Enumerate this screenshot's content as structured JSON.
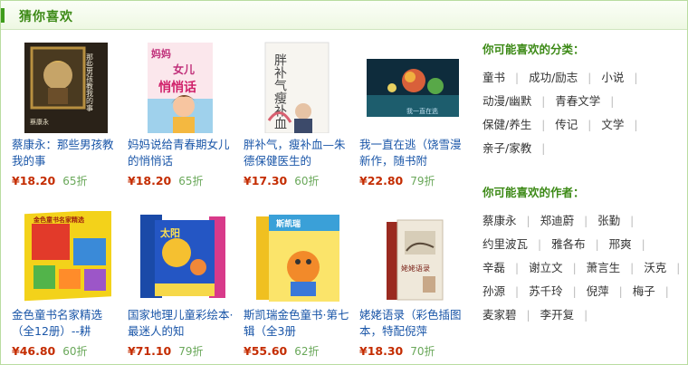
{
  "section_title": "猜你喜欢",
  "products": [
    {
      "title": "蔡康永：那些男孩教我的事",
      "price": "¥18.20",
      "discount": "65折",
      "cover": "boys-book"
    },
    {
      "title": "妈妈说给青春期女儿的悄悄话",
      "price": "¥18.20",
      "discount": "65折",
      "cover": "mom-whisper"
    },
    {
      "title": "胖补气，瘦补血—朱德保健医生的",
      "price": "¥17.30",
      "discount": "60折",
      "cover": "health-book"
    },
    {
      "title": "我一直在逃（饶雪漫新作，随书附",
      "price": "¥22.80",
      "discount": "79折",
      "cover": "escape-book"
    },
    {
      "title": "金色童书名家精选（全12册）--耕",
      "price": "¥46.80",
      "discount": "60折",
      "cover": "golden-books"
    },
    {
      "title": "国家地理儿童彩绘本·最迷人的知",
      "price": "¥71.10",
      "discount": "79折",
      "cover": "geo-books"
    },
    {
      "title": "斯凯瑞金色童书·第七辑（全3册",
      "price": "¥55.60",
      "discount": "62折",
      "cover": "scarry-books"
    },
    {
      "title": "姥姥语录（彩色插图本，特配倪萍",
      "price": "¥18.30",
      "discount": "70折",
      "cover": "grandma-book"
    }
  ],
  "covers": {
    "boys_title": "那些男孩教我的事",
    "boys_author": "蔡康永",
    "mom_line1": "妈妈",
    "mom_line2": "女儿",
    "mom_line3": "悄悄话",
    "health_title": "胖补气瘦补血",
    "escape_caption": "我一直在逃",
    "golden_title": "金色童书名家精选",
    "geo_title": "太阳",
    "scarry_title": "斯凯瑞",
    "grandma_title": "姥姥语录"
  },
  "categories": {
    "heading": "你可能喜欢的分类：",
    "rows": [
      [
        "童书",
        "成功/励志",
        "小说"
      ],
      [
        "动漫/幽默",
        "青春文学"
      ],
      [
        "保健/养生",
        "传记",
        "文学"
      ],
      [
        "亲子/家教"
      ]
    ]
  },
  "authors": {
    "heading": "你可能喜欢的作者：",
    "rows": [
      [
        "蔡康永",
        "郑迪蔚",
        "张勤"
      ],
      [
        "约里波瓦",
        "雅各布",
        "邢爽"
      ],
      [
        "辛磊",
        "谢立文",
        "萧言生",
        "沃克"
      ],
      [
        "孙源",
        "苏千玲",
        "倪萍",
        "梅子"
      ],
      [
        "麦家碧",
        "李开复"
      ]
    ]
  },
  "colors": {
    "accent_green": "#3d8a17",
    "link_blue": "#1a56a8",
    "price_red": "#c42c00",
    "discount_green": "#6aa85a"
  }
}
